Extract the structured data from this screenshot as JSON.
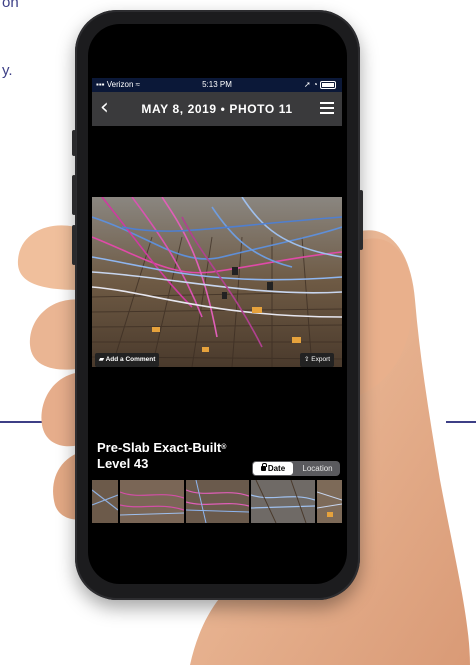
{
  "status_bar": {
    "carrier": "Verizon",
    "time": "5:13 PM"
  },
  "nav": {
    "title": "MAY 8, 2019 • PHOTO 11"
  },
  "photo_actions": {
    "comment_label": "Add a Comment",
    "export_label": "Export"
  },
  "caption": {
    "line1": "Pre-Slab Exact-Built",
    "line1_mark": "®",
    "line2": "Level 43"
  },
  "sort_toggle": {
    "options": [
      "Date",
      "Location"
    ],
    "selected": "Date"
  },
  "thumbnails": {
    "count": 6,
    "selected_index": 2
  },
  "background_text": {
    "line1": "on",
    "line2": "y."
  },
  "colors": {
    "status_bar_bg": "#0b1838",
    "nav_bar_bg": "#3a3a3c",
    "thumb_selected": "#d6602a",
    "accent_text": "#3d3f86"
  }
}
